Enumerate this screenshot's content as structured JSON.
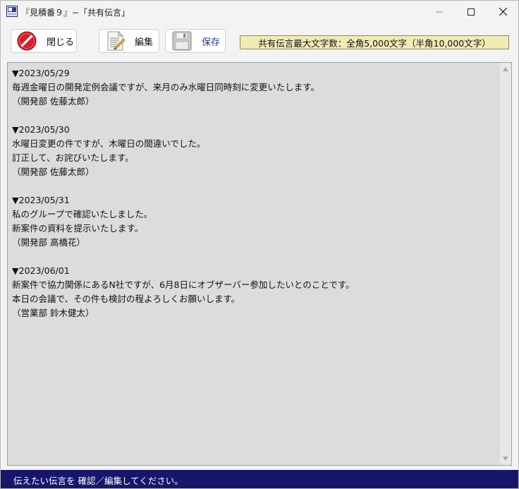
{
  "window": {
    "title": "『見積番９』−「共有伝言」"
  },
  "toolbar": {
    "close_label": "閉じる",
    "edit_label": "編集",
    "save_label": "保存",
    "limit_note": "共有伝言最大文字数：全角5,000文字（半角10,000文字）"
  },
  "editor": {
    "content": "▼2023/05/29\n毎週金曜日の開発定例会議ですが、来月のみ水曜日同時刻に変更いたします。\n（開発部 佐藤太郎）\n\n▼2023/05/30\n水曜日変更の件ですが、木曜日の間違いでした。\n訂正して、お詫びいたします。\n（開発部 佐藤太郎）\n\n▼2023/05/31\n私のグループで確認いたしました。\n新案件の資料を提示いたします。\n（開発部 高橋花）\n\n▼2023/06/01\n新案件で協力関係にあるN社ですが、6月8日にオブザーバー参加したいとのことです。\n本日の会議で、その件も検討の程よろしくお願いします。\n（営業部 鈴木健太）"
  },
  "statusbar": {
    "text": "伝えたい伝言を 確認／編集してください。"
  },
  "icons": {
    "app": "app-icon",
    "close": "no-entry-icon",
    "edit": "document-pencil-icon",
    "save": "floppy-disk-icon"
  },
  "colors": {
    "statusbar_bg": "#16166b",
    "note_bg": "#f0eab5",
    "editor_bg": "#dcdcdc",
    "close_icon_red": "#d4202a"
  }
}
